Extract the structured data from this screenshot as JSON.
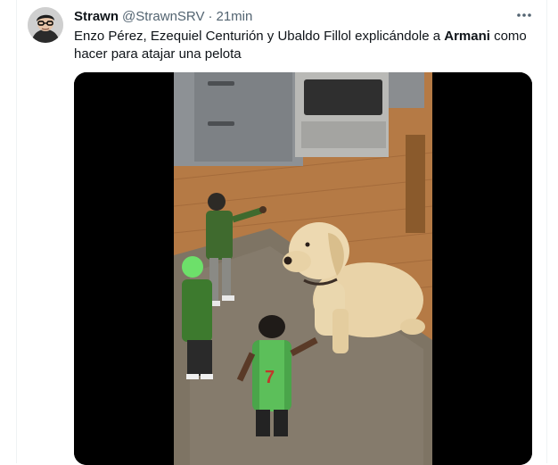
{
  "tweet": {
    "author_name": "Strawn",
    "author_handle": "@StrawnSRV",
    "separator": "·",
    "time": "21min",
    "text_before": "Enzo Pérez, Ezequiel Centurión y Ubaldo Fillol explicándole a ",
    "text_bold": "Armani",
    "text_after": " como hacer para atajar una pelota",
    "more_icon": "more-horizontal-icon",
    "avatar_icon": "avatar-glasses-icon"
  },
  "media": {
    "jersey_number": "7"
  }
}
